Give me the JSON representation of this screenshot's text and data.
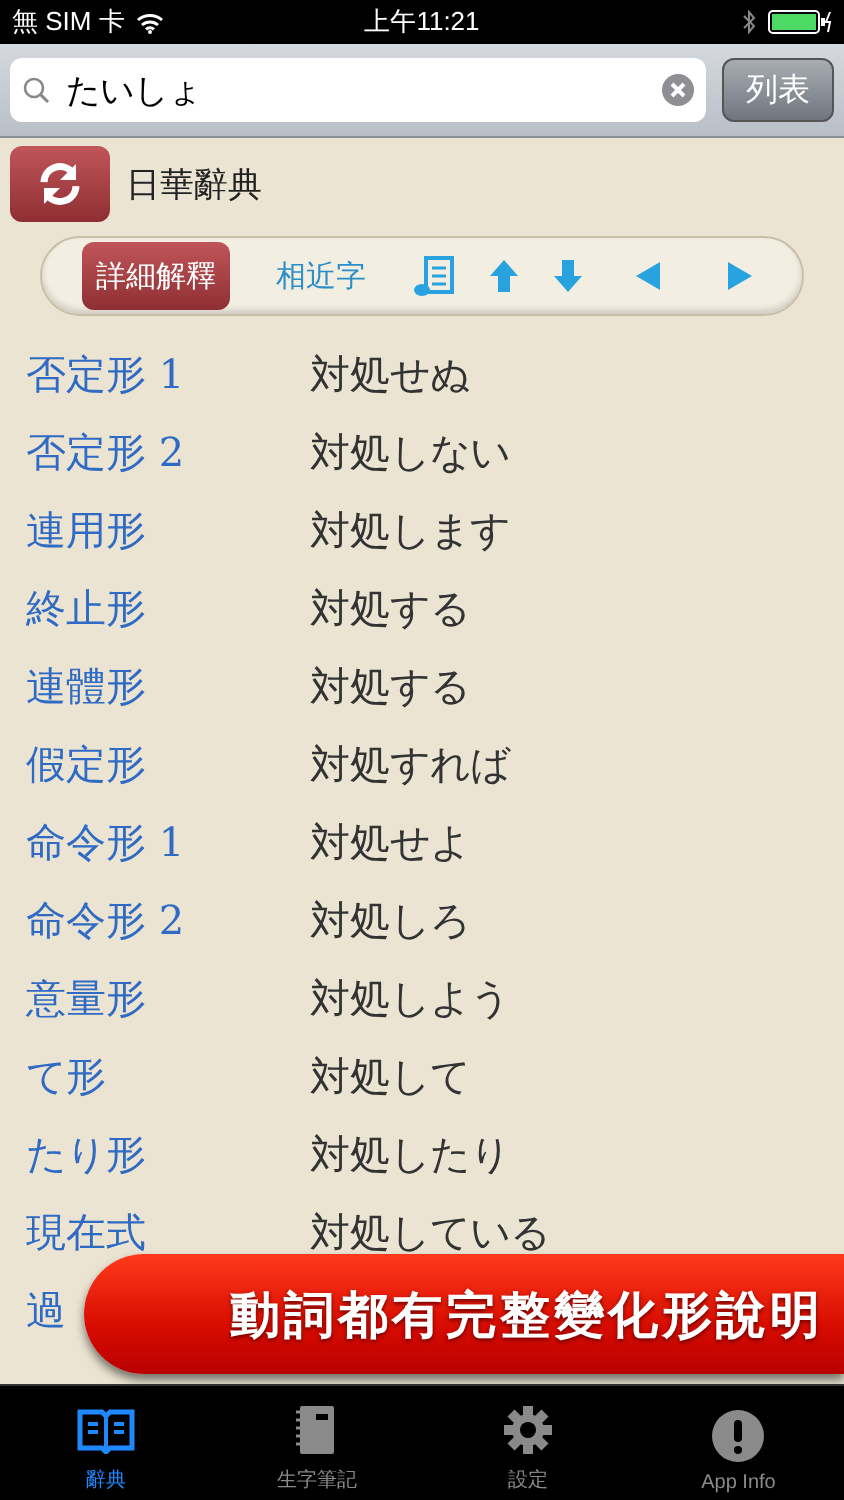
{
  "status_bar": {
    "carrier": "無 SIM 卡",
    "time": "上午11:21"
  },
  "search": {
    "value": "たいしょ",
    "button": "列表"
  },
  "header": {
    "title": "日華辭典"
  },
  "toolbar": {
    "tabs": [
      {
        "label": "詳細解釋",
        "selected": true
      },
      {
        "label": "相近字",
        "selected": false
      }
    ]
  },
  "forms": [
    {
      "label": "否定形 1",
      "value": "対処せぬ"
    },
    {
      "label": "否定形 2",
      "value": "対処しない"
    },
    {
      "label": "連用形",
      "value": "対処します"
    },
    {
      "label": "終止形",
      "value": "対処する"
    },
    {
      "label": "連體形",
      "value": "対処する"
    },
    {
      "label": "假定形",
      "value": "対処すれば"
    },
    {
      "label": "命令形 1",
      "value": "対処せよ"
    },
    {
      "label": "命令形 2",
      "value": "対処しろ"
    },
    {
      "label": "意量形",
      "value": "対処しよう"
    },
    {
      "label": "て形",
      "value": "対処して"
    },
    {
      "label": "たり形",
      "value": "対処したり"
    },
    {
      "label": "現在式",
      "value": "対処している"
    },
    {
      "label": "過"
    }
  ],
  "banner": {
    "text": "動詞都有完整變化形說明"
  },
  "tab_bar": [
    {
      "label": "辭典",
      "kind": "book",
      "selected": true
    },
    {
      "label": "生字筆記",
      "kind": "notebook",
      "selected": false
    },
    {
      "label": "設定",
      "kind": "gear",
      "selected": false
    },
    {
      "label": "App Info",
      "kind": "info",
      "selected": false
    }
  ]
}
